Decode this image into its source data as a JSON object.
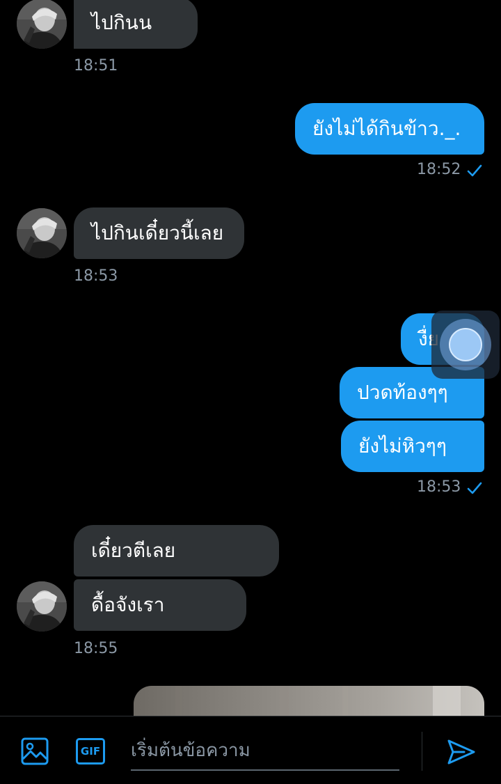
{
  "conversation": {
    "messages": [
      {
        "direction": "incoming",
        "text": "ไปกินน"
      },
      {
        "direction": "outgoing",
        "text": "ยังไม่ได้กินข้าว._."
      },
      {
        "direction": "incoming",
        "text": "ไปกินเดี๋ยวนี้เลย"
      },
      {
        "direction": "outgoing",
        "text": "งื่ย"
      },
      {
        "direction": "outgoing",
        "text": "ปวดท้องๆๆ"
      },
      {
        "direction": "outgoing",
        "text": "ยังไม่หิวๆๆ"
      },
      {
        "direction": "incoming",
        "text": "เดี๋ยวตีเลย"
      },
      {
        "direction": "incoming",
        "text": "ดื้อจังเรา"
      }
    ],
    "timestamps": [
      "18:51",
      "18:52",
      "18:53",
      "18:53",
      "18:55"
    ],
    "read_receipt_icon": "check-icon"
  },
  "composer": {
    "placeholder": "เริ่มต้นข้อความ",
    "image_icon": "image-icon",
    "gif_label": "GIF",
    "send_icon": "send-icon"
  },
  "colors": {
    "background": "#000000",
    "incoming_bubble": "#2f3336",
    "outgoing_bubble": "#1d9bf0",
    "accent": "#1d9bf0",
    "timestamp": "#8b98a5"
  }
}
